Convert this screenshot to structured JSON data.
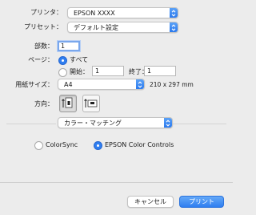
{
  "printer": {
    "label": "プリンタ：",
    "value": "EPSON XXXX"
  },
  "preset": {
    "label": "プリセット：",
    "value": "デフォルト設定"
  },
  "copies": {
    "label": "部数：",
    "value": "1"
  },
  "pages": {
    "label": "ページ：",
    "all_label": "すべて",
    "from_label": "開始：",
    "from_value": "1",
    "to_label": "終了：",
    "to_value": "1"
  },
  "paper_size": {
    "label": "用紙サイズ：",
    "value": "A4",
    "dimensions": "210 x 297 mm"
  },
  "orientation": {
    "label": "方向：",
    "selected": "portrait"
  },
  "section": {
    "value": "カラー・マッチング"
  },
  "color_options": [
    {
      "label": "ColorSync",
      "selected": false
    },
    {
      "label": "EPSON Color Controls",
      "selected": true
    }
  ],
  "buttons": {
    "cancel": "キャンセル",
    "print": "プリント"
  },
  "colors": {
    "accent": "#2f7ef0",
    "background": "#ececec"
  }
}
